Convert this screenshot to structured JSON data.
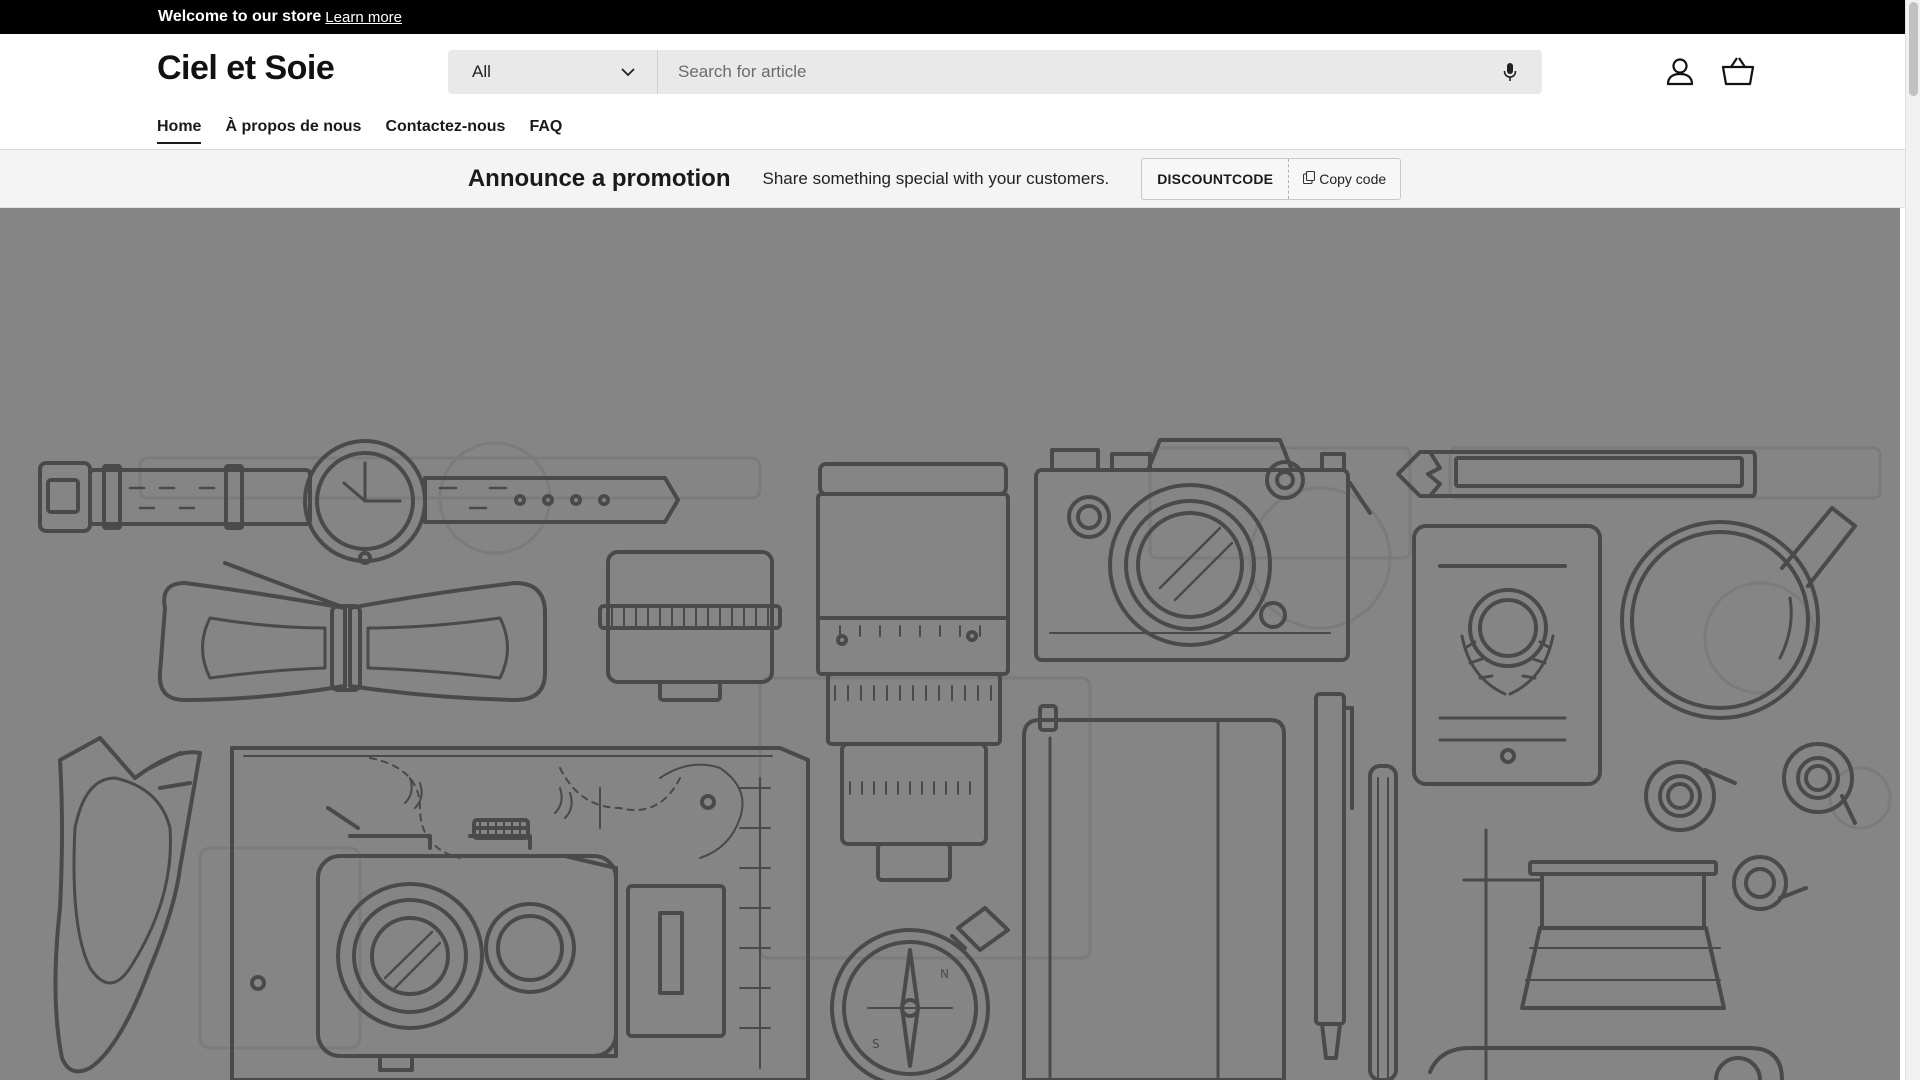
{
  "announcement": {
    "text": "Welcome to our store",
    "link_label": "Learn more"
  },
  "header": {
    "logo": "Ciel et Soie",
    "search": {
      "category_selected": "All",
      "placeholder": "Search for article"
    },
    "icons": [
      "user-icon",
      "basket-icon",
      "microphone-icon",
      "chevron-down-icon"
    ]
  },
  "nav": {
    "items": [
      {
        "label": "Home",
        "active": true
      },
      {
        "label": "À propos de nous",
        "active": false
      },
      {
        "label": "Contactez-nous",
        "active": false
      },
      {
        "label": "FAQ",
        "active": false
      }
    ]
  },
  "promo": {
    "title": "Announce a promotion",
    "text": "Share something special with your customers.",
    "code": "DISCOUNTCODE",
    "copy_label": "Copy code"
  },
  "hero": {
    "background_color": "#858585",
    "illustration": "line-art flat lay: wristwatch, bow tie, camera lenses, cameras, notebook, pen, pencil, passport, magnifying glass, tape rolls, sunglasses, map, compass"
  },
  "colors": {
    "announcement_bg": "#000000",
    "search_bg": "#e9e9e9",
    "promo_bg": "#f4f4f4",
    "line_art": "#4a4a4a"
  }
}
